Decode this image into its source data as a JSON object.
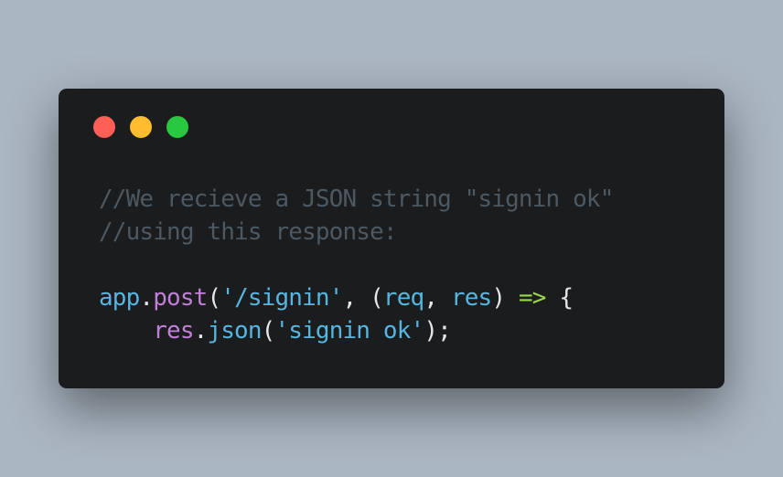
{
  "colors": {
    "background": "#aab6c2",
    "window": "#1b1c1e",
    "close_dot": "#ff5f57",
    "minimize_dot": "#febc2e",
    "maximize_dot": "#28c840",
    "comment": "#4c5862",
    "identifier": "#56b6e0",
    "function": "#c17fd8",
    "arrow": "#98d84a",
    "punctuation": "#e6e6e6"
  },
  "code": {
    "line1": "//We recieve a JSON string \"signin ok\"",
    "line2": "//using this response:",
    "line4": {
      "app": "app",
      "dot": ".",
      "post": "post",
      "open": "(",
      "route": "'/signin'",
      "comma1": ", ",
      "params_open": "(",
      "req": "req",
      "comma2": ", ",
      "res": "res",
      "params_close": ") ",
      "arrow": "=>",
      "brace": " {"
    },
    "line5": {
      "indent": "    ",
      "res": "res",
      "dot": ".",
      "json": "json",
      "open": "(",
      "message": "'signin ok'",
      "close": ");"
    }
  }
}
